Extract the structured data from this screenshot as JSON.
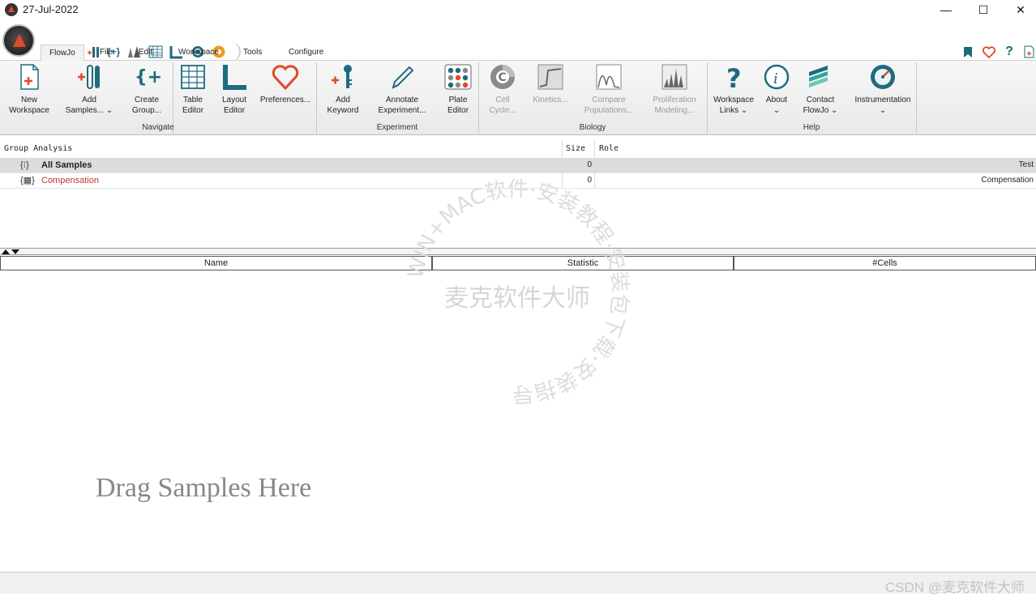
{
  "window": {
    "title": "27-Jul-2022",
    "minimize": "—",
    "maximize": "☐",
    "close": "✕"
  },
  "menu": {
    "tabs": [
      "FlowJo",
      "File",
      "Edit",
      "Workspace",
      "Tools",
      "Configure"
    ],
    "active": "FlowJo"
  },
  "ribbon": {
    "navigate": {
      "label": "Navigate",
      "buttons": [
        {
          "line1": "New",
          "line2": "Workspace"
        },
        {
          "line1": "Add",
          "line2": "Samples... ⌄"
        },
        {
          "line1": "Create",
          "line2": "Group..."
        },
        {
          "line1": "Table",
          "line2": "Editor"
        },
        {
          "line1": "Layout",
          "line2": "Editor"
        },
        {
          "line1": "Preferences...",
          "line2": ""
        }
      ]
    },
    "experiment": {
      "label": "Experiment",
      "buttons": [
        {
          "line1": "Add",
          "line2": "Keyword"
        },
        {
          "line1": "Annotate",
          "line2": "Experiment..."
        },
        {
          "line1": "Plate",
          "line2": "Editor"
        }
      ]
    },
    "biology": {
      "label": "Biology",
      "buttons": [
        {
          "line1": "Cell",
          "line2": "Cycle..."
        },
        {
          "line1": "Kinetics...",
          "line2": ""
        },
        {
          "line1": "Compare",
          "line2": "Populations..."
        },
        {
          "line1": "Proliferation",
          "line2": "Modeling..."
        }
      ]
    },
    "help": {
      "label": "Help",
      "buttons": [
        {
          "line1": "Workspace",
          "line2": "Links ⌄"
        },
        {
          "line1": "About",
          "line2": "⌄"
        },
        {
          "line1": "Contact",
          "line2": "FlowJo ⌄"
        },
        {
          "line1": "Instrumentation",
          "line2": "⌄"
        }
      ]
    }
  },
  "groups_table": {
    "headers": {
      "name": "Group Analysis",
      "size": "Size",
      "role": "Role"
    },
    "rows": [
      {
        "icon": "{⁝}",
        "name": "All Samples",
        "size": "0",
        "role": "Test"
      },
      {
        "icon": "{▦}",
        "name": "Compensation",
        "size": "0",
        "role": "Compensation"
      }
    ]
  },
  "samples_table": {
    "headers": [
      "Name",
      "Statistic",
      "#Cells"
    ]
  },
  "main": {
    "drag_hint": "Drag Samples Here"
  },
  "watermark": {
    "ring": "WIN+MAC软件·安装教程·安装包下载·安装指导",
    "center": "麦克软件大师"
  },
  "footer": {
    "credit": "CSDN @麦克软件大师"
  },
  "colors": {
    "accent": "#e0482b",
    "teal": "#1e6b7e",
    "compensation_text": "#c0392b"
  }
}
